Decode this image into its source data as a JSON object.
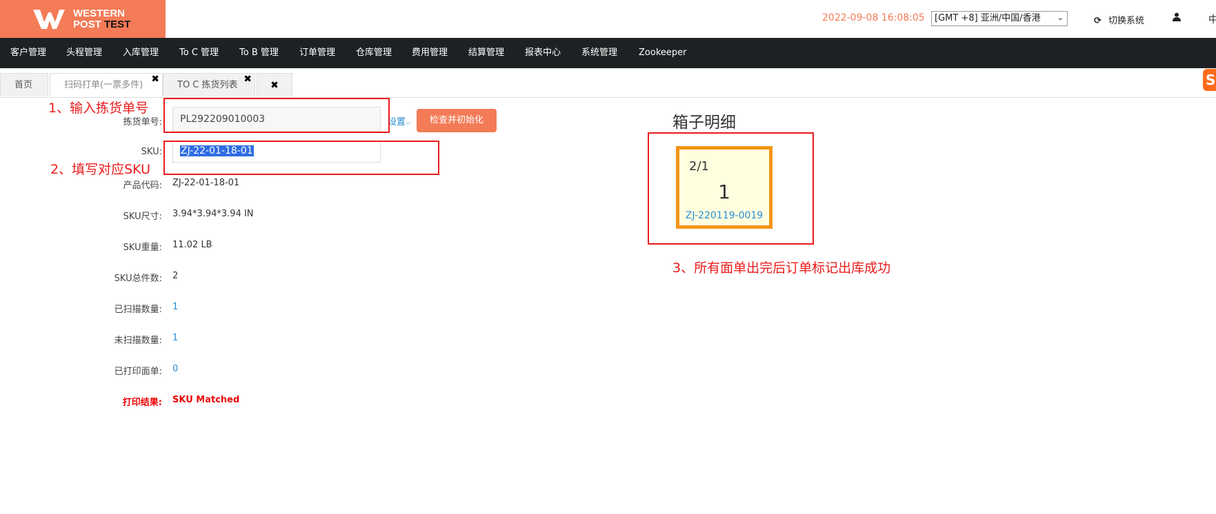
{
  "header": {
    "logo_line1": "WESTERN",
    "logo_line2": "POST",
    "logo_test": "TEST",
    "datetime": "2022-09-08 16:08:05",
    "timezone": "[GMT +8] 亚洲/中国/香港",
    "switch_system": "切换系统",
    "lang": "中"
  },
  "nav": [
    "客户管理",
    "头程管理",
    "入库管理",
    "To C 管理",
    "To B 管理",
    "订单管理",
    "仓库管理",
    "费用管理",
    "结算管理",
    "报表中心",
    "系统管理",
    "Zookeeper"
  ],
  "tabs": {
    "home": "首页",
    "scan_print": "扫码打单(一票多件)",
    "toc_pick": "TO C 拣货列表"
  },
  "form": {
    "pick_no_label": "拣货单号:",
    "pick_no_value": "PL292209010003",
    "settings": "设置",
    "check_button": "检查并初始化",
    "sku_label": "SKU:",
    "sku_value": "ZJ-22-01-18-01",
    "product_code_label": "产品代码:",
    "product_code_value": "ZJ-22-01-18-01",
    "sku_size_label": "SKU尺寸:",
    "sku_size_value": "3.94*3.94*3.94 IN",
    "sku_weight_label": "SKU重量:",
    "sku_weight_value": "11.02 LB",
    "sku_total_label": "SKU总件数:",
    "sku_total_value": "2",
    "scanned_label": "已扫描数量:",
    "scanned_value": "1",
    "unscanned_label": "未扫描数量:",
    "unscanned_value": "1",
    "printed_label": "已打印面单:",
    "printed_value": "0",
    "result_label": "打印结果:",
    "result_value": "SKU Matched"
  },
  "box_detail": {
    "title": "箱子明细",
    "index": "2/1",
    "count": "1",
    "code": "ZJ-220119-0019"
  },
  "annotations": {
    "step1": "1、输入拣货单号",
    "step2": "2、填写对应SKU",
    "step3": "3、所有面单出完后订单标记出库成功"
  },
  "colors": {
    "brand": "#f47b57",
    "nav_bg": "#1e2124",
    "annotation": "#ea1b1b",
    "link": "#2a8dd4",
    "box_border": "#f39517"
  }
}
